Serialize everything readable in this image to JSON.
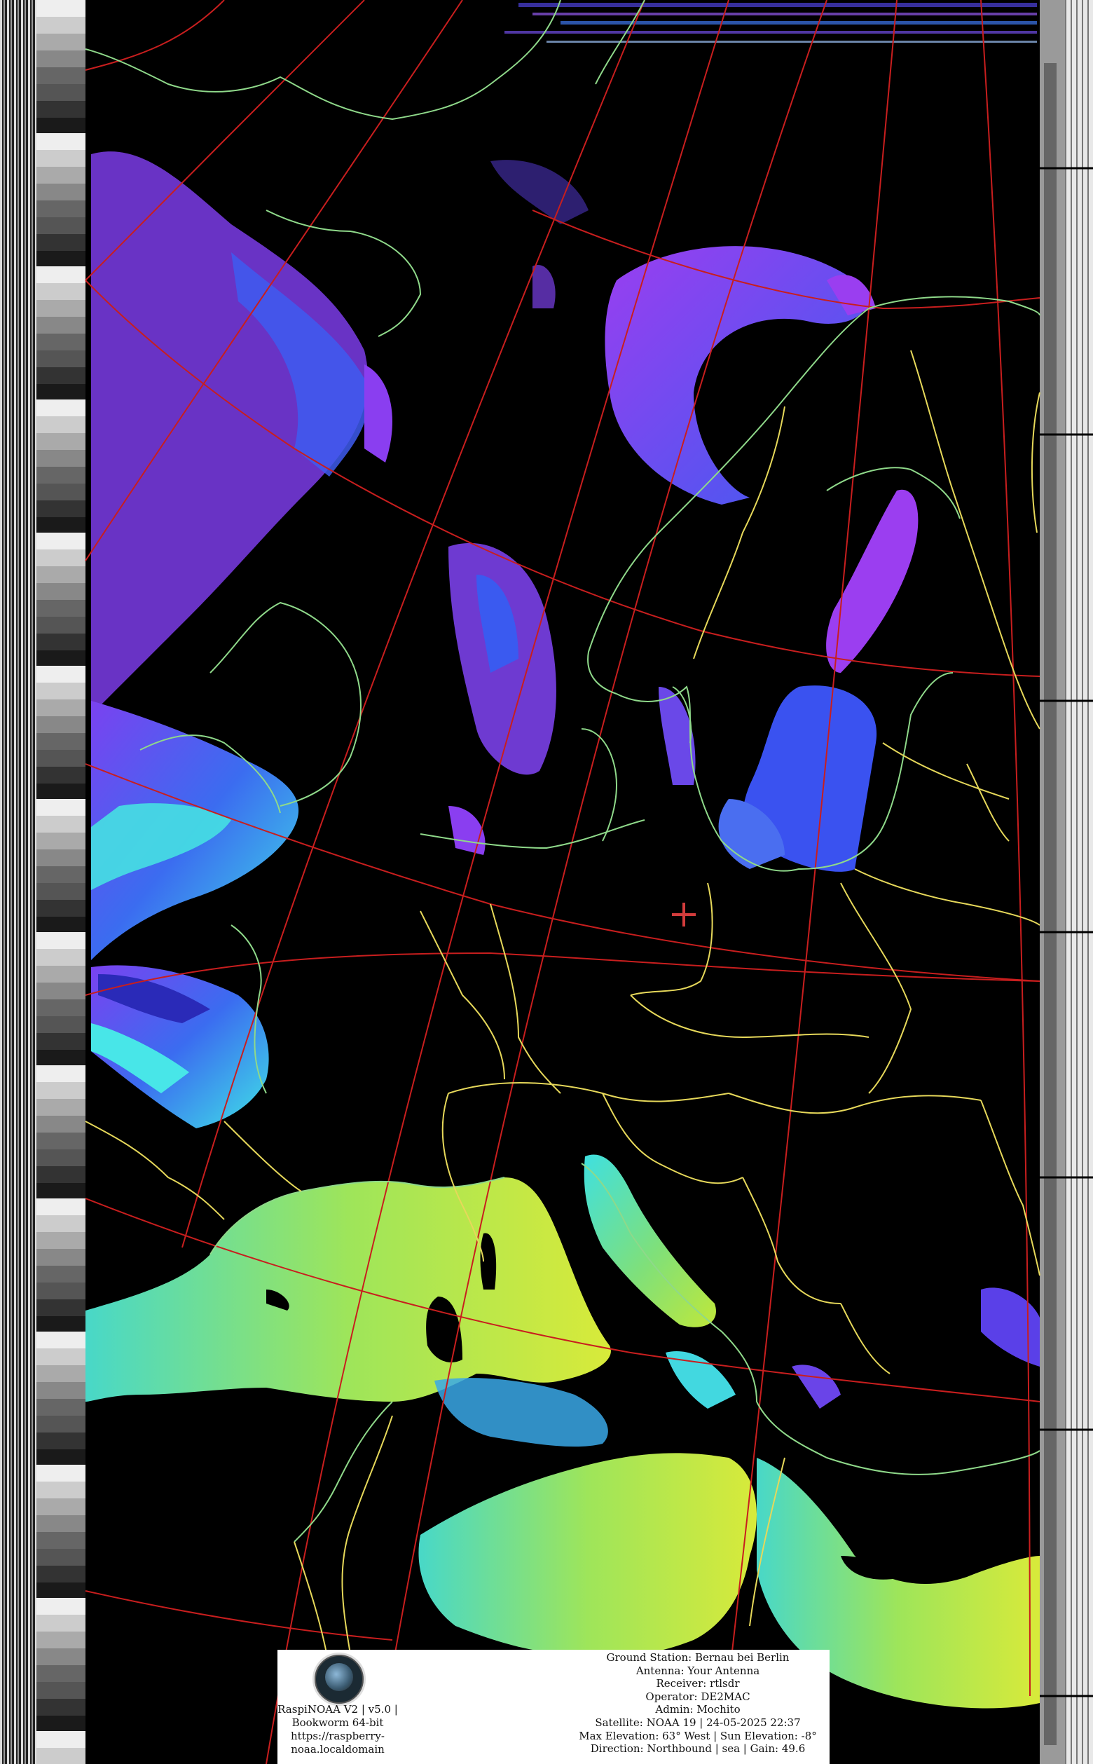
{
  "image": {
    "kind": "NOAA APT satellite image, MCIR-style false color with map overlay",
    "colors": {
      "background": "#000000",
      "coastline": "#8fd98a",
      "borders": "#e6d85a",
      "graticule": "#c81e1e",
      "cloud_purple": "#8a3cf0",
      "cloud_blue": "#3a55f0",
      "sea_cyan": "#3fe0e0",
      "sea_green": "#8fe04a",
      "station_marker": "#d23c3c"
    },
    "icons": [
      "station-crosshair-icon",
      "raspinoaa-logo-icon"
    ]
  },
  "footer": {
    "left_lines": [
      "RaspiNOAA V2 | v5.0 |",
      "Bookworm 64-bit",
      "https://raspberry-",
      "noaa.localdomain"
    ],
    "right_lines": [
      "Ground Station: Bernau bei Berlin",
      "Antenna: Your Antenna",
      "Receiver: rtlsdr",
      "Operator: DE2MAC",
      "Admin: Mochito",
      "Satellite: NOAA 19 | 24-05-2025 22:37",
      "Max Elevation: 63° West | Sun Elevation: -8°",
      "Direction: Northbound | sea | Gain: 49.6"
    ]
  }
}
